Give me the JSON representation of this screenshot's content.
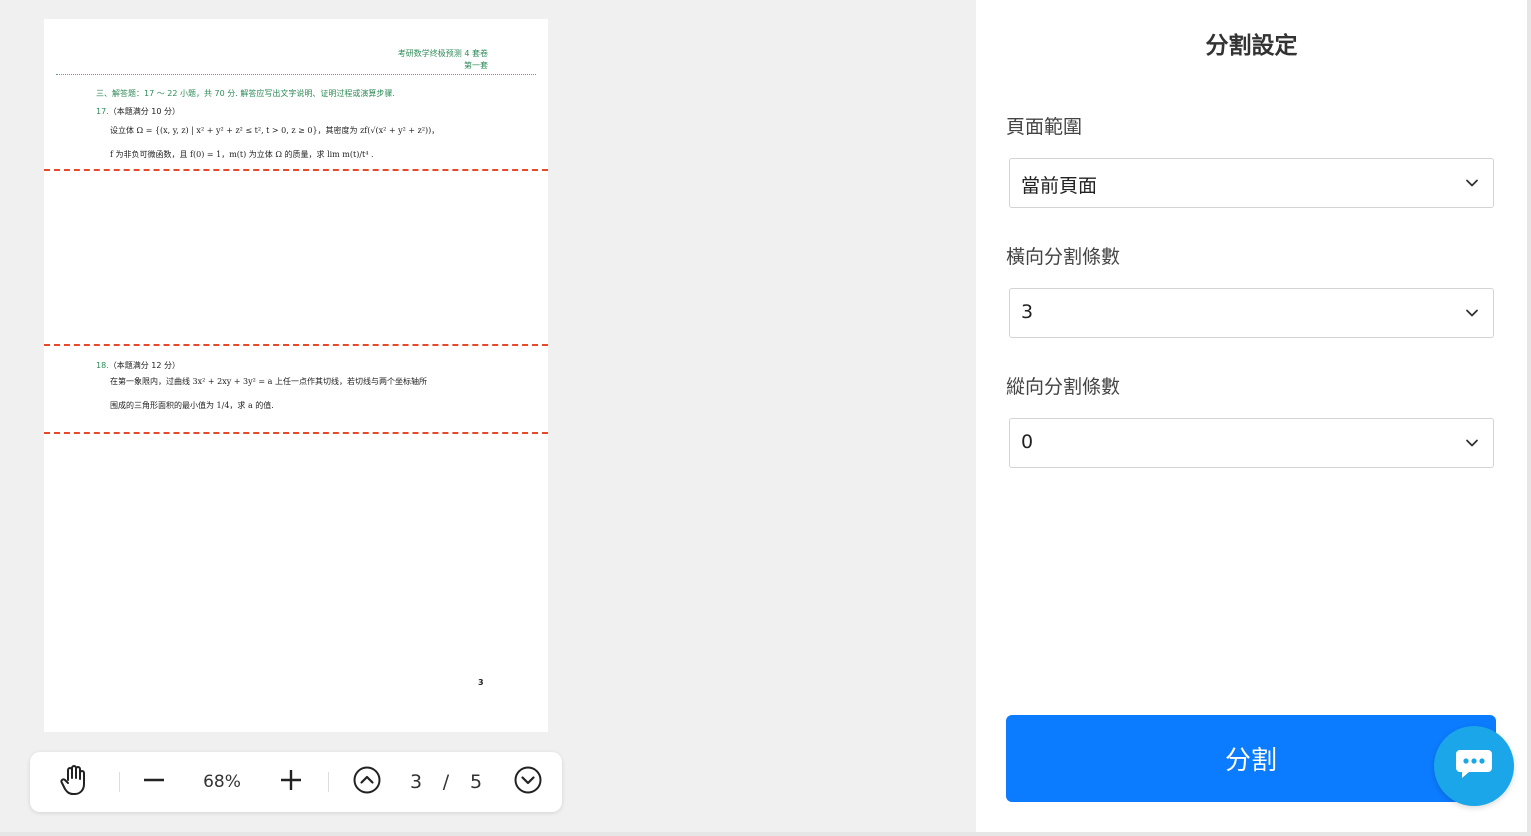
{
  "preview": {
    "header_line1": "考研数学终极预测 4 套卷",
    "header_line2": "第一套",
    "section_title": "三、解答题：17 ～ 22 小题，共 70 分. 解答应写出文字说明、证明过程或演算步骤.",
    "q17_num": "17.",
    "q17_head": "（本题满分 10 分）",
    "q17_line1": "设立体 Ω = {(x, y, z) | x² + y² + z² ≤ t², t > 0, z ≥ 0}，其密度为 zf(√(x² + y² + z²))，",
    "q17_line2": "f 为非负可微函数，且 f(0) = 1，m(t) 为立体 Ω 的质量，求 lim m(t)/t⁴ .",
    "q18_num": "18.",
    "q18_head": "（本题满分 12 分）",
    "q18_line1": "在第一象限内，过曲线 3x² + 2xy + 3y² = a 上任一点作其切线，若切线与两个坐标轴所",
    "q18_line2": "围成的三角形面积的最小值为 1/4，求 a 的值.",
    "page_number": "3"
  },
  "toolbar": {
    "pan_icon": "hand-icon",
    "zoom_out_icon": "minus-icon",
    "zoom_level": "68%",
    "zoom_in_icon": "plus-icon",
    "prev_icon": "chevron-up-circle-icon",
    "current_page": "3",
    "page_separator": "/",
    "total_pages": "5",
    "next_icon": "chevron-down-circle-icon"
  },
  "panel": {
    "title": "分割設定",
    "page_range_label": "頁面範圍",
    "page_range_value": "當前頁面",
    "horizontal_label": "橫向分割條數",
    "horizontal_value": "3",
    "vertical_label": "縱向分割條數",
    "vertical_value": "0",
    "split_button": "分割"
  },
  "chat": {
    "icon": "chat-icon"
  },
  "colors": {
    "accent": "#0b7bff",
    "cut_line": "#e8492a",
    "chat": "#1aa6e8",
    "doc_green": "#2e8b57"
  }
}
